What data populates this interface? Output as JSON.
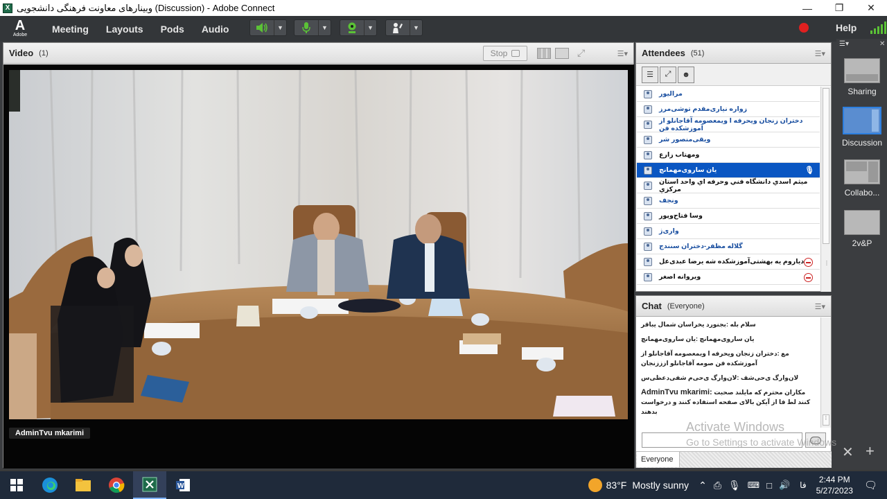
{
  "window": {
    "title": "وبینارهای معاونت فرهنگی دانشجویی (Discussion) - Adobe Connect",
    "app_icon_letter": "X"
  },
  "menubar": {
    "logo_mark": "A",
    "logo_text": "Adobe",
    "items": [
      "Meeting",
      "Layouts",
      "Pods",
      "Audio"
    ],
    "help_label": "Help"
  },
  "video_pod": {
    "title": "Video",
    "count": "(1)",
    "stop_label": "Stop",
    "speaker_label": "AdminTvu mkarimi"
  },
  "attendees_pod": {
    "title": "Attendees",
    "count": "(51)",
    "rows": [
      {
        "name": "مرالیور",
        "style": "host",
        "status": ""
      },
      {
        "name": "زواره نیاری‌مقدم توشی‌مرز",
        "style": "host",
        "status": ""
      },
      {
        "name": "دختران زنجان ویحرفه ا ویمعصومه آقاجانلو از آموزشکده فن",
        "style": "host",
        "status": ""
      },
      {
        "name": "ویقی‌منصور شر",
        "style": "host",
        "status": ""
      },
      {
        "name": "ومهتاب زارع",
        "style": "part",
        "status": ""
      },
      {
        "name": "یان ساروی‌مهمانچ",
        "style": "sel",
        "status": "mic"
      },
      {
        "name": "میثم اسدي دانشگاه فني وحرفه اي واحد استان مركزي",
        "style": "part",
        "status": ""
      },
      {
        "name": "ونجف",
        "style": "host",
        "status": ""
      },
      {
        "name": "وسا فتاح‌وپور",
        "style": "part",
        "status": ""
      },
      {
        "name": "واری‌ژ",
        "style": "host",
        "status": ""
      },
      {
        "name": "گلاله مظفر-دختران سنندج",
        "style": "host",
        "status": ""
      },
      {
        "name": "دیاروم یه بهشتی‌آموزشکده شه یرضا عبدی‌عل",
        "style": "part",
        "status": "minus"
      },
      {
        "name": "ویروانه اصغر",
        "style": "part",
        "status": "minus"
      }
    ]
  },
  "chat_pod": {
    "title": "Chat",
    "audience": "(Everyone)",
    "messages": [
      {
        "from": "",
        "text": "سلام بله :بجنورد یخراسان شمال یباقر"
      },
      {
        "from": "",
        "text": "یان ساروی‌مهمانچ :یان ساروی‌مهمانچ"
      },
      {
        "from": "",
        "text": "مع :دختران زنجان ویحرفه ا ویمعصومه آقاجانلو از آموزشکده فن صومه آقاجانلو ازززنجان"
      },
      {
        "from": "",
        "text": "لان‌وارگ ی‌حی‌شف :لان‌وارگ ی‌حی‌م شفی‌دعظی‌س"
      },
      {
        "from": "AdminTvu mkarimi:",
        "text": " مکاران محترم که مایلند صحبت کنند لط فا از آیکن بالای صفحه استفاده کنند و درخواست بدهند"
      }
    ],
    "tab_label": "Everyone"
  },
  "watermark": {
    "line1": "Activate Windows",
    "line2": "Go to Settings to activate Windows."
  },
  "layouts_panel": {
    "items": [
      "Sharing",
      "Discussion",
      "Collabo...",
      "2v&P"
    ],
    "selected": "Discussion"
  },
  "taskbar": {
    "temperature": "83°F",
    "weather": "Mostly sunny",
    "lang": "فا",
    "time": "2:44 PM",
    "date": "5/27/2023"
  }
}
